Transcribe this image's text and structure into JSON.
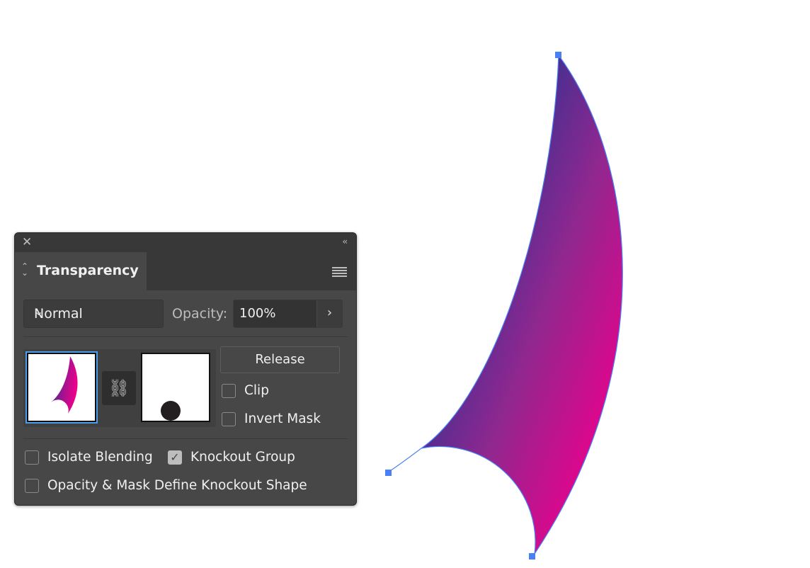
{
  "panel": {
    "title": "Transparency",
    "blend_mode": "Normal",
    "opacity_label": "Opacity:",
    "opacity_value": "100%",
    "release_label": "Release",
    "clip_label": "Clip",
    "clip_checked": false,
    "invert_mask_label": "Invert Mask",
    "invert_mask_checked": false,
    "isolate_blending_label": "Isolate Blending",
    "isolate_blending_checked": false,
    "knockout_group_label": "Knockout Group",
    "knockout_group_checked": true,
    "opacity_mask_knockout_label": "Opacity & Mask Define Knockout Shape",
    "opacity_mask_knockout_checked": false
  },
  "colors": {
    "gradient_start": "#2e3192",
    "gradient_end": "#ec008c",
    "selection": "#4a80f5"
  }
}
